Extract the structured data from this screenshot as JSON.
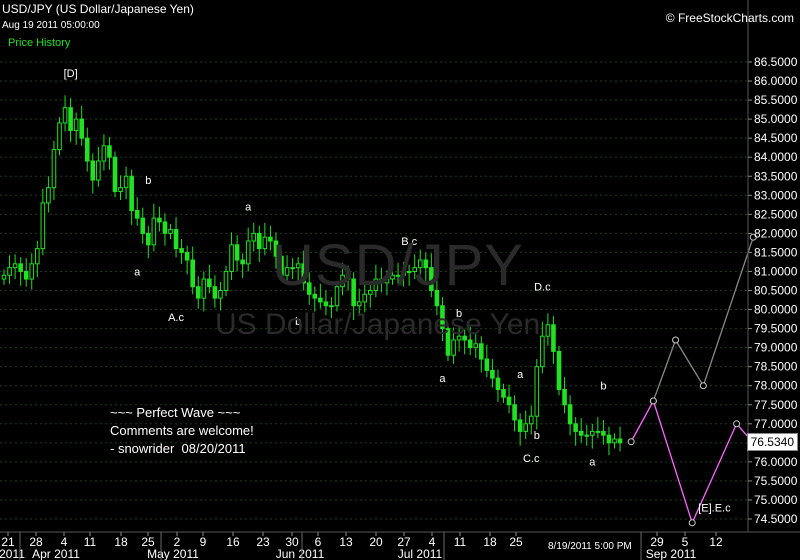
{
  "header": {
    "symbol": "USD/JPY (US Dollar/Japanese Yen)",
    "timestamp": "Aug 19 2011 05:00:00",
    "series_label": "Price History",
    "copyright": "© FreeStockCharts.com"
  },
  "watermark": {
    "symbol": "USD/JPY",
    "name": "US Dollar/Japanese Yen"
  },
  "note": {
    "lines": [
      "~~~ Perfect Wave ~~~",
      "Comments are welcome!",
      "- snowrider  08/20/2011"
    ]
  },
  "last_price": "76.5340",
  "cursor_date": "8/19/2011 5:00 PM",
  "colors": {
    "background": "#000000",
    "candle": "#22e022",
    "projection_pink": "#ff66ff",
    "projection_gray": "#888888",
    "grid": "#1f3a1f"
  },
  "chart_data": {
    "type": "candlestick",
    "title": "USD/JPY (US Dollar/Japanese Yen)",
    "y_axis": {
      "position": "right",
      "ylim": [
        74.25,
        86.75
      ],
      "ticks": [
        "74.5000",
        "75.0000",
        "75.5000",
        "76.0000",
        "76.5000",
        "77.0000",
        "77.5000",
        "78.0000",
        "78.5000",
        "79.0000",
        "79.5000",
        "80.0000",
        "80.5000",
        "81.0000",
        "81.5000",
        "82.0000",
        "82.5000",
        "83.0000",
        "83.5000",
        "84.0000",
        "84.5000",
        "85.0000",
        "85.5000",
        "86.0000",
        "86.5000"
      ]
    },
    "x_axis": {
      "tick_labels": [
        "21",
        "28",
        "4",
        "11",
        "18",
        "25",
        "2",
        "9",
        "16",
        "23",
        "30",
        "6",
        "13",
        "20",
        "27",
        "4",
        "11",
        "18",
        "25",
        "29",
        "5",
        "12"
      ],
      "month_labels": [
        "2011",
        "Apr 2011",
        "May 2011",
        "Jun 2011",
        "Jul 2011",
        "Sep 2011"
      ]
    },
    "closes": [
      80.9,
      81.1,
      81.2,
      81.0,
      80.8,
      81.2,
      81.6,
      82.8,
      83.2,
      84.2,
      84.9,
      85.3,
      84.7,
      85.0,
      84.5,
      83.9,
      83.4,
      83.9,
      84.3,
      84.0,
      83.1,
      83.2,
      83.5,
      82.6,
      82.4,
      82.0,
      81.7,
      82.4,
      82.3,
      82.0,
      82.1,
      81.6,
      81.5,
      81.3,
      80.6,
      80.3,
      80.8,
      80.6,
      80.3,
      80.5,
      81.0,
      81.7,
      81.3,
      81.2,
      81.8,
      82.0,
      81.6,
      81.9,
      81.8,
      81.4,
      80.9,
      81.1,
      81.1,
      81.2,
      80.7,
      80.4,
      80.3,
      80.2,
      80.1,
      80.1,
      80.6,
      80.9,
      80.8,
      80.1,
      80.2,
      80.4,
      80.5,
      80.8,
      80.7,
      80.8,
      80.9,
      80.9,
      81.0,
      81.0,
      81.1,
      81.3,
      81.1,
      80.5,
      80.1,
      79.5,
      78.8,
      79.2,
      79.3,
      79.2,
      79.0,
      79.1,
      78.7,
      78.4,
      78.2,
      77.9,
      77.7,
      77.5,
      77.1,
      76.8,
      77.0,
      77.2,
      78.5,
      79.3,
      79.6,
      78.9,
      77.9,
      77.5,
      77.0,
      76.8,
      76.7,
      76.7,
      76.8,
      76.8,
      76.7,
      76.5,
      76.6,
      76.5
    ],
    "candle_count": 112,
    "wave_labels": [
      {
        "text": "[D]",
        "bar": 12,
        "value": 86.1
      },
      {
        "text": "b",
        "bar": 26,
        "value": 83.3
      },
      {
        "text": "a",
        "bar": 24,
        "value": 80.9
      },
      {
        "text": "A.c",
        "bar": 31,
        "value": 79.7
      },
      {
        "text": "a",
        "bar": 44,
        "value": 82.6
      },
      {
        "text": "b",
        "bar": 53,
        "value": 79.6
      },
      {
        "text": "B.c",
        "bar": 73,
        "value": 81.7
      },
      {
        "text": "a",
        "bar": 79,
        "value": 78.1
      },
      {
        "text": "b",
        "bar": 82,
        "value": 79.8
      },
      {
        "text": "a",
        "bar": 93,
        "value": 78.2
      },
      {
        "text": "D.c",
        "bar": 97,
        "value": 80.5
      },
      {
        "text": "b",
        "bar": 96,
        "value": 76.6
      },
      {
        "text": "C.c",
        "bar": 95,
        "value": 76.0
      },
      {
        "text": "b",
        "bar": 108,
        "value": 77.9
      },
      {
        "text": "a",
        "bar": 106,
        "value": 75.9
      },
      {
        "text": "[E].E.c",
        "bar": 128,
        "value": 74.7
      }
    ],
    "projection_pink": [
      {
        "bar": 113,
        "value": 76.53
      },
      {
        "bar": 117,
        "value": 77.6
      },
      {
        "bar": 124,
        "value": 74.4
      },
      {
        "bar": 132,
        "value": 77.0
      },
      {
        "bar": 135,
        "value": 76.5
      }
    ],
    "projection_gray": [
      {
        "bar": 117,
        "value": 77.6
      },
      {
        "bar": 121,
        "value": 79.2
      },
      {
        "bar": 126,
        "value": 78.0
      },
      {
        "bar": 135,
        "value": 81.9
      }
    ]
  }
}
